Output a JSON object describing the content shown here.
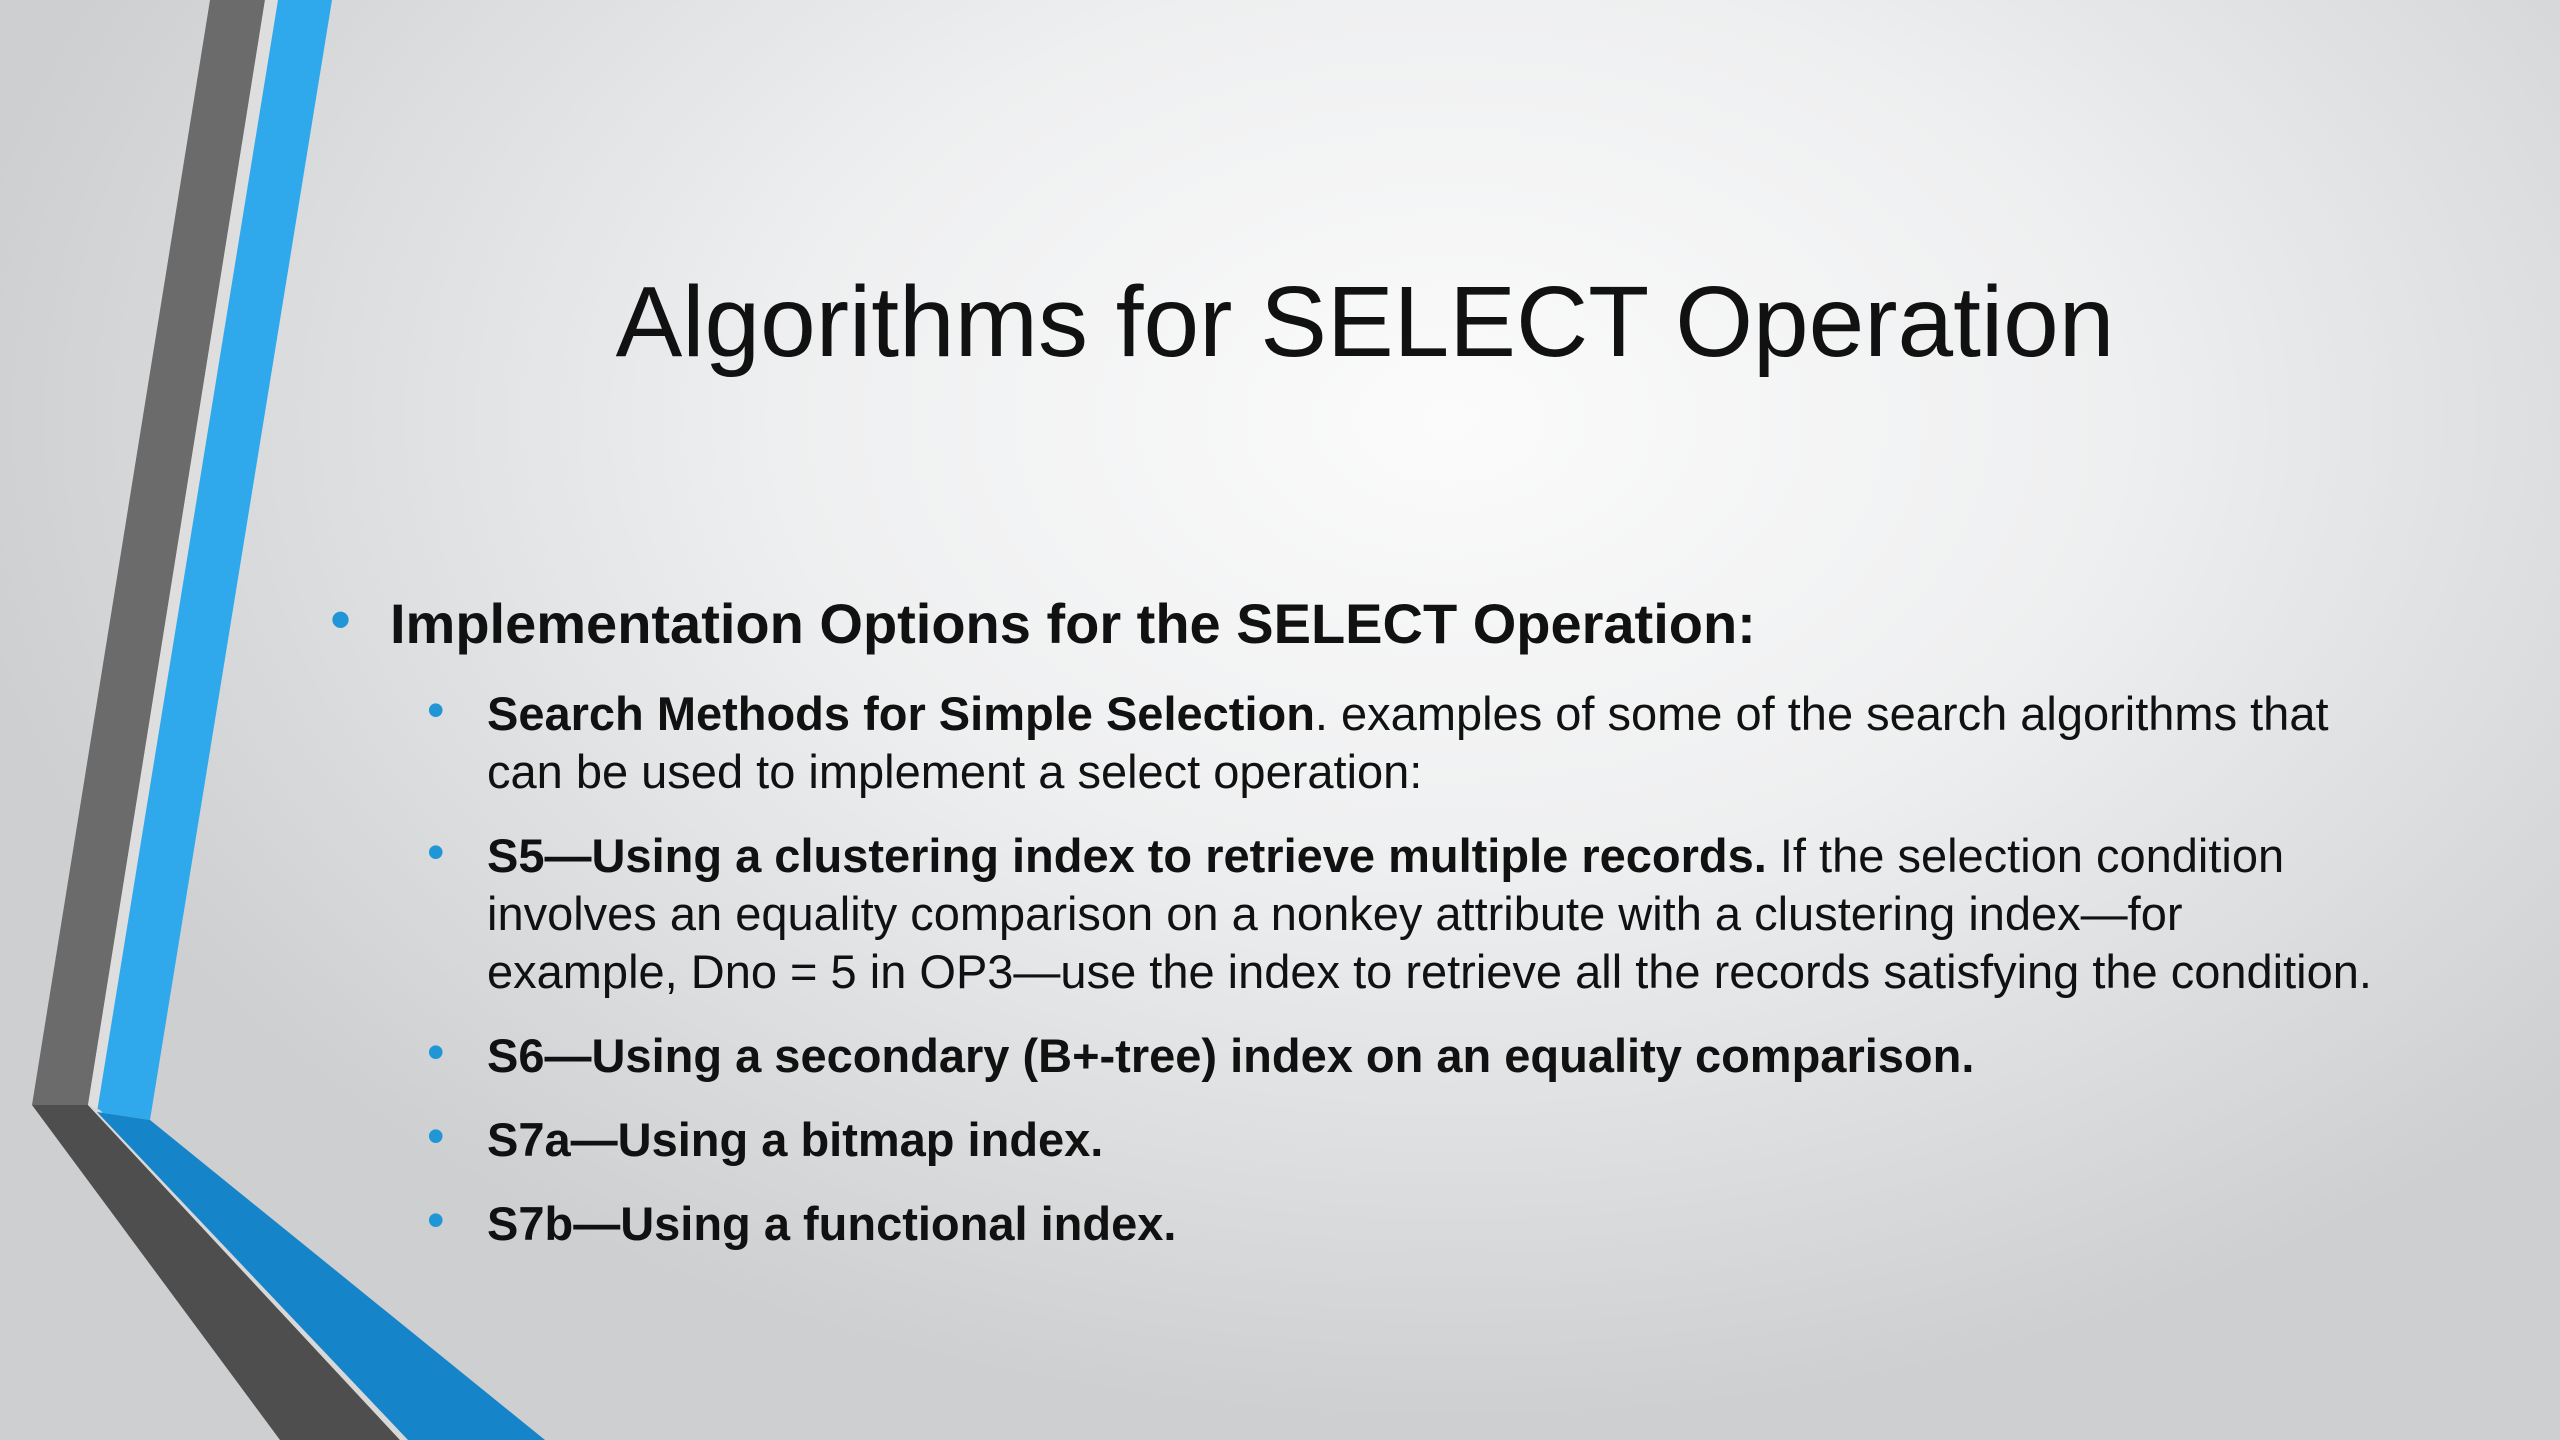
{
  "slide": {
    "title": "Algorithms for SELECT Operation",
    "accent_color": "#2196d6",
    "main_bullet": "Implementation Options for the SELECT Operation:",
    "sub_bullets": [
      {
        "bold": "Search Methods for Simple Selection",
        "text": ". examples of some of the search algorithms that can be used to implement a select operation:"
      },
      {
        "bold": "S5—Using a clustering index to retrieve multiple records.",
        "text": " If the selection condition involves an equality comparison on a nonkey attribute with a clustering index—for example, Dno = 5 in OP3—use the index to retrieve all the records satisfying the condition."
      },
      {
        "bold": "S6—Using a secondary (B+-tree) index on an equality comparison.",
        "text": ""
      },
      {
        "bold": "S7a—Using a bitmap index.",
        "text": ""
      },
      {
        "bold": "S7b—Using a functional index.",
        "text": ""
      }
    ]
  }
}
